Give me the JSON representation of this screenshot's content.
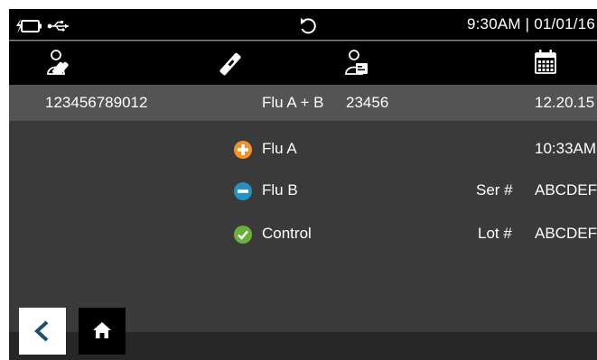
{
  "status": {
    "time_date": "9:30AM | 01/01/16",
    "icons": [
      "battery-charging-icon",
      "usb-icon",
      "rotate-icon"
    ]
  },
  "header_icons": [
    "operator-id-icon",
    "test-strip-icon",
    "patient-id-icon",
    "calendar-icon"
  ],
  "record": {
    "patient_id": "123456789012",
    "test_name": "Flu A + B",
    "test_id": "23456",
    "date": "12.20.15",
    "time": "10:33AM"
  },
  "results": [
    {
      "label": "Flu A",
      "icon": "positive-plus-icon",
      "color": "#f2922b"
    },
    {
      "label": "Flu B",
      "icon": "negative-minus-icon",
      "color": "#2a8fc1"
    },
    {
      "label": "Control",
      "icon": "valid-check-icon",
      "color": "#6dae3c"
    }
  ],
  "device": {
    "serial_label": "Ser #",
    "serial_value": "ABCDEF",
    "lot_label": "Lot #",
    "lot_value": "ABCDEF"
  },
  "nav": {
    "back_icon": "chevron-left-icon",
    "home_icon": "home-icon",
    "accent": "#1a4f73"
  }
}
